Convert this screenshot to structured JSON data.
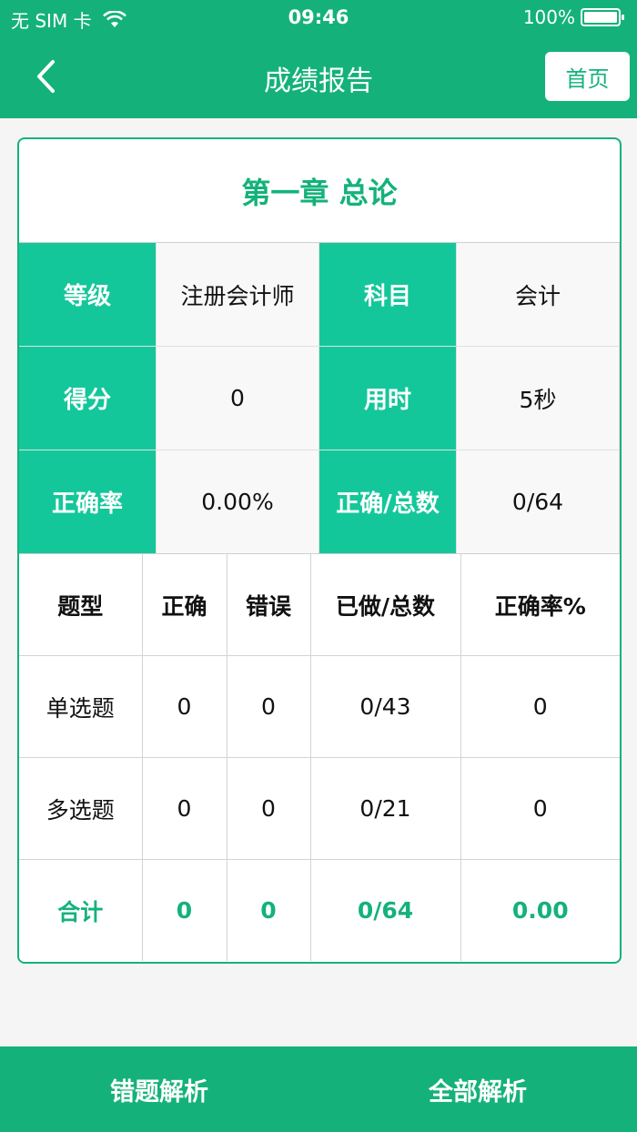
{
  "status_bar": {
    "carrier": "无 SIM 卡",
    "time": "09:46",
    "battery": "100%"
  },
  "nav": {
    "title": "成绩报告",
    "home_label": "首页"
  },
  "report": {
    "chapter": "第一章 总论",
    "info": [
      {
        "label1": "等级",
        "value1": "注册会计师",
        "label2": "科目",
        "value2": "会计"
      },
      {
        "label1": "得分",
        "value1": "0",
        "label2": "用时",
        "value2": "5秒"
      },
      {
        "label1": "正确率",
        "value1": "0.00%",
        "label2": "正确/总数",
        "value2": "0/64"
      }
    ],
    "table": {
      "headers": [
        "题型",
        "正确",
        "错误",
        "已做/总数",
        "正确率%"
      ],
      "rows": [
        [
          "单选题",
          "0",
          "0",
          "0/43",
          "0"
        ],
        [
          "多选题",
          "0",
          "0",
          "0/21",
          "0"
        ]
      ],
      "total": [
        "合计",
        "0",
        "0",
        "0/64",
        "0.00"
      ]
    }
  },
  "bottom": {
    "wrong_analysis": "错题解析",
    "all_analysis": "全部解析"
  },
  "colors": {
    "primary": "#14b27a",
    "label_bg": "#14c79a"
  }
}
